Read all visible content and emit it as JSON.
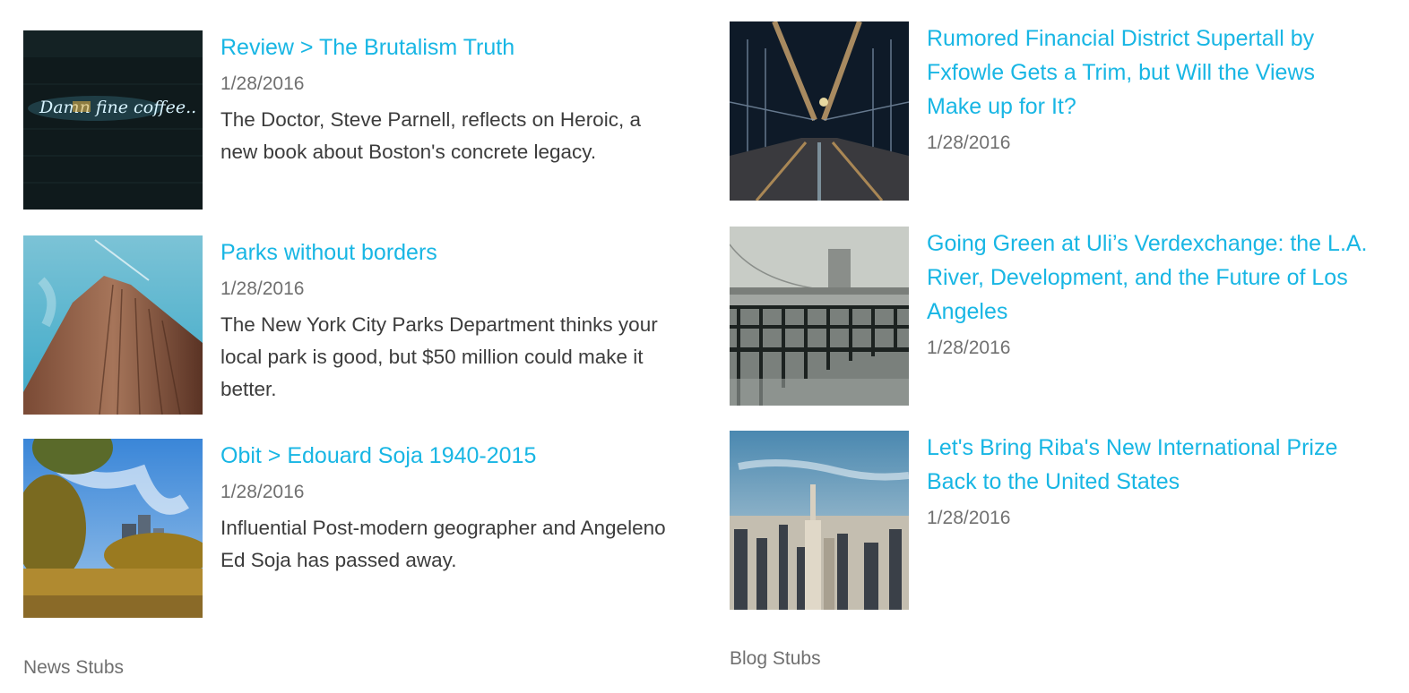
{
  "news": {
    "section_label": "News Stubs",
    "items": [
      {
        "title": "Review > The Brutalism Truth",
        "date": "1/28/2016",
        "description": "The Doctor, Steve Parnell, reflects on Heroic, a new book about Boston's concrete legacy.",
        "image": "neon-sign-photo"
      },
      {
        "title": "Parks without borders",
        "date": "1/28/2016",
        "description": "The New York City Parks Department thinks your local park is good, but $50 million could make it better.",
        "image": "skyscraper-photo"
      },
      {
        "title": "Obit > Edouard Soja 1940-2015",
        "date": "1/28/2016",
        "description": "Influential Post-modern geographer and Angeleno Ed Soja has passed away.",
        "image": "park-skyline-photo"
      }
    ]
  },
  "blog": {
    "section_label": "Blog Stubs",
    "items": [
      {
        "title": "Rumored Financial District Supertall by Fxfowle Gets a Trim, but Will the Views Make up for It?",
        "date": "1/28/2016",
        "image": "bridge-night-photo"
      },
      {
        "title": "Going Green at Uli’s Verdexchange: the L.A. River, Development, and the Future of Los Angeles",
        "date": "1/28/2016",
        "image": "waterfront-benches-photo"
      },
      {
        "title": "Let's Bring Riba's New International Prize Back to the United States",
        "date": "1/28/2016",
        "image": "city-aerial-photo"
      }
    ]
  },
  "colors": {
    "link": "#18b6e4",
    "date": "#707070",
    "body": "#3c3c3c"
  }
}
